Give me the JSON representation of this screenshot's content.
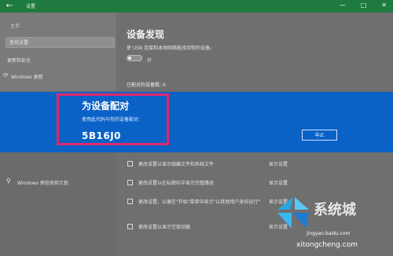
{
  "titlebar": {
    "title": "设置",
    "back_symbol": "←"
  },
  "sidebar": {
    "home": "主页",
    "search_placeholder": "查找设置",
    "section": "更新和安全",
    "items": [
      {
        "label": "Windows 更新",
        "icon": "refresh-icon"
      }
    ],
    "insider": {
      "label": "Windows 预览体验计划",
      "icon": "person-icon"
    }
  },
  "main": {
    "heading": "设备发现",
    "description": "使 USB 连接和本地网络能找到你的设备。",
    "toggle_label": "开",
    "paired_label": "已配对的设备数: 0"
  },
  "dialog": {
    "title": "为设备配对",
    "description": "使用此代码与你的设备配对:",
    "code": "5B16J0",
    "stop_button": "中止"
  },
  "options": [
    {
      "text": "更改设置以显示隐藏文件和系统文件",
      "link": "显示设置"
    },
    {
      "text": "更改设置以在标题栏中显示完整路径",
      "link": "显示设置"
    },
    {
      "text": "更改设置，以便在\"开始\"菜单中显示\"以其他用户身份运行\"",
      "link": "显示设置"
    },
    {
      "text": "更改设置以显示空驱动器",
      "link": "显示设置"
    }
  ],
  "watermark": {
    "brand_text": "系统城",
    "url": "xitongcheng.com",
    "url2": "jingyan.baidu.com"
  },
  "colors": {
    "overlay": "#0a62c6",
    "highlight": "#e2276e",
    "titlebar": "#1f7a3f"
  }
}
